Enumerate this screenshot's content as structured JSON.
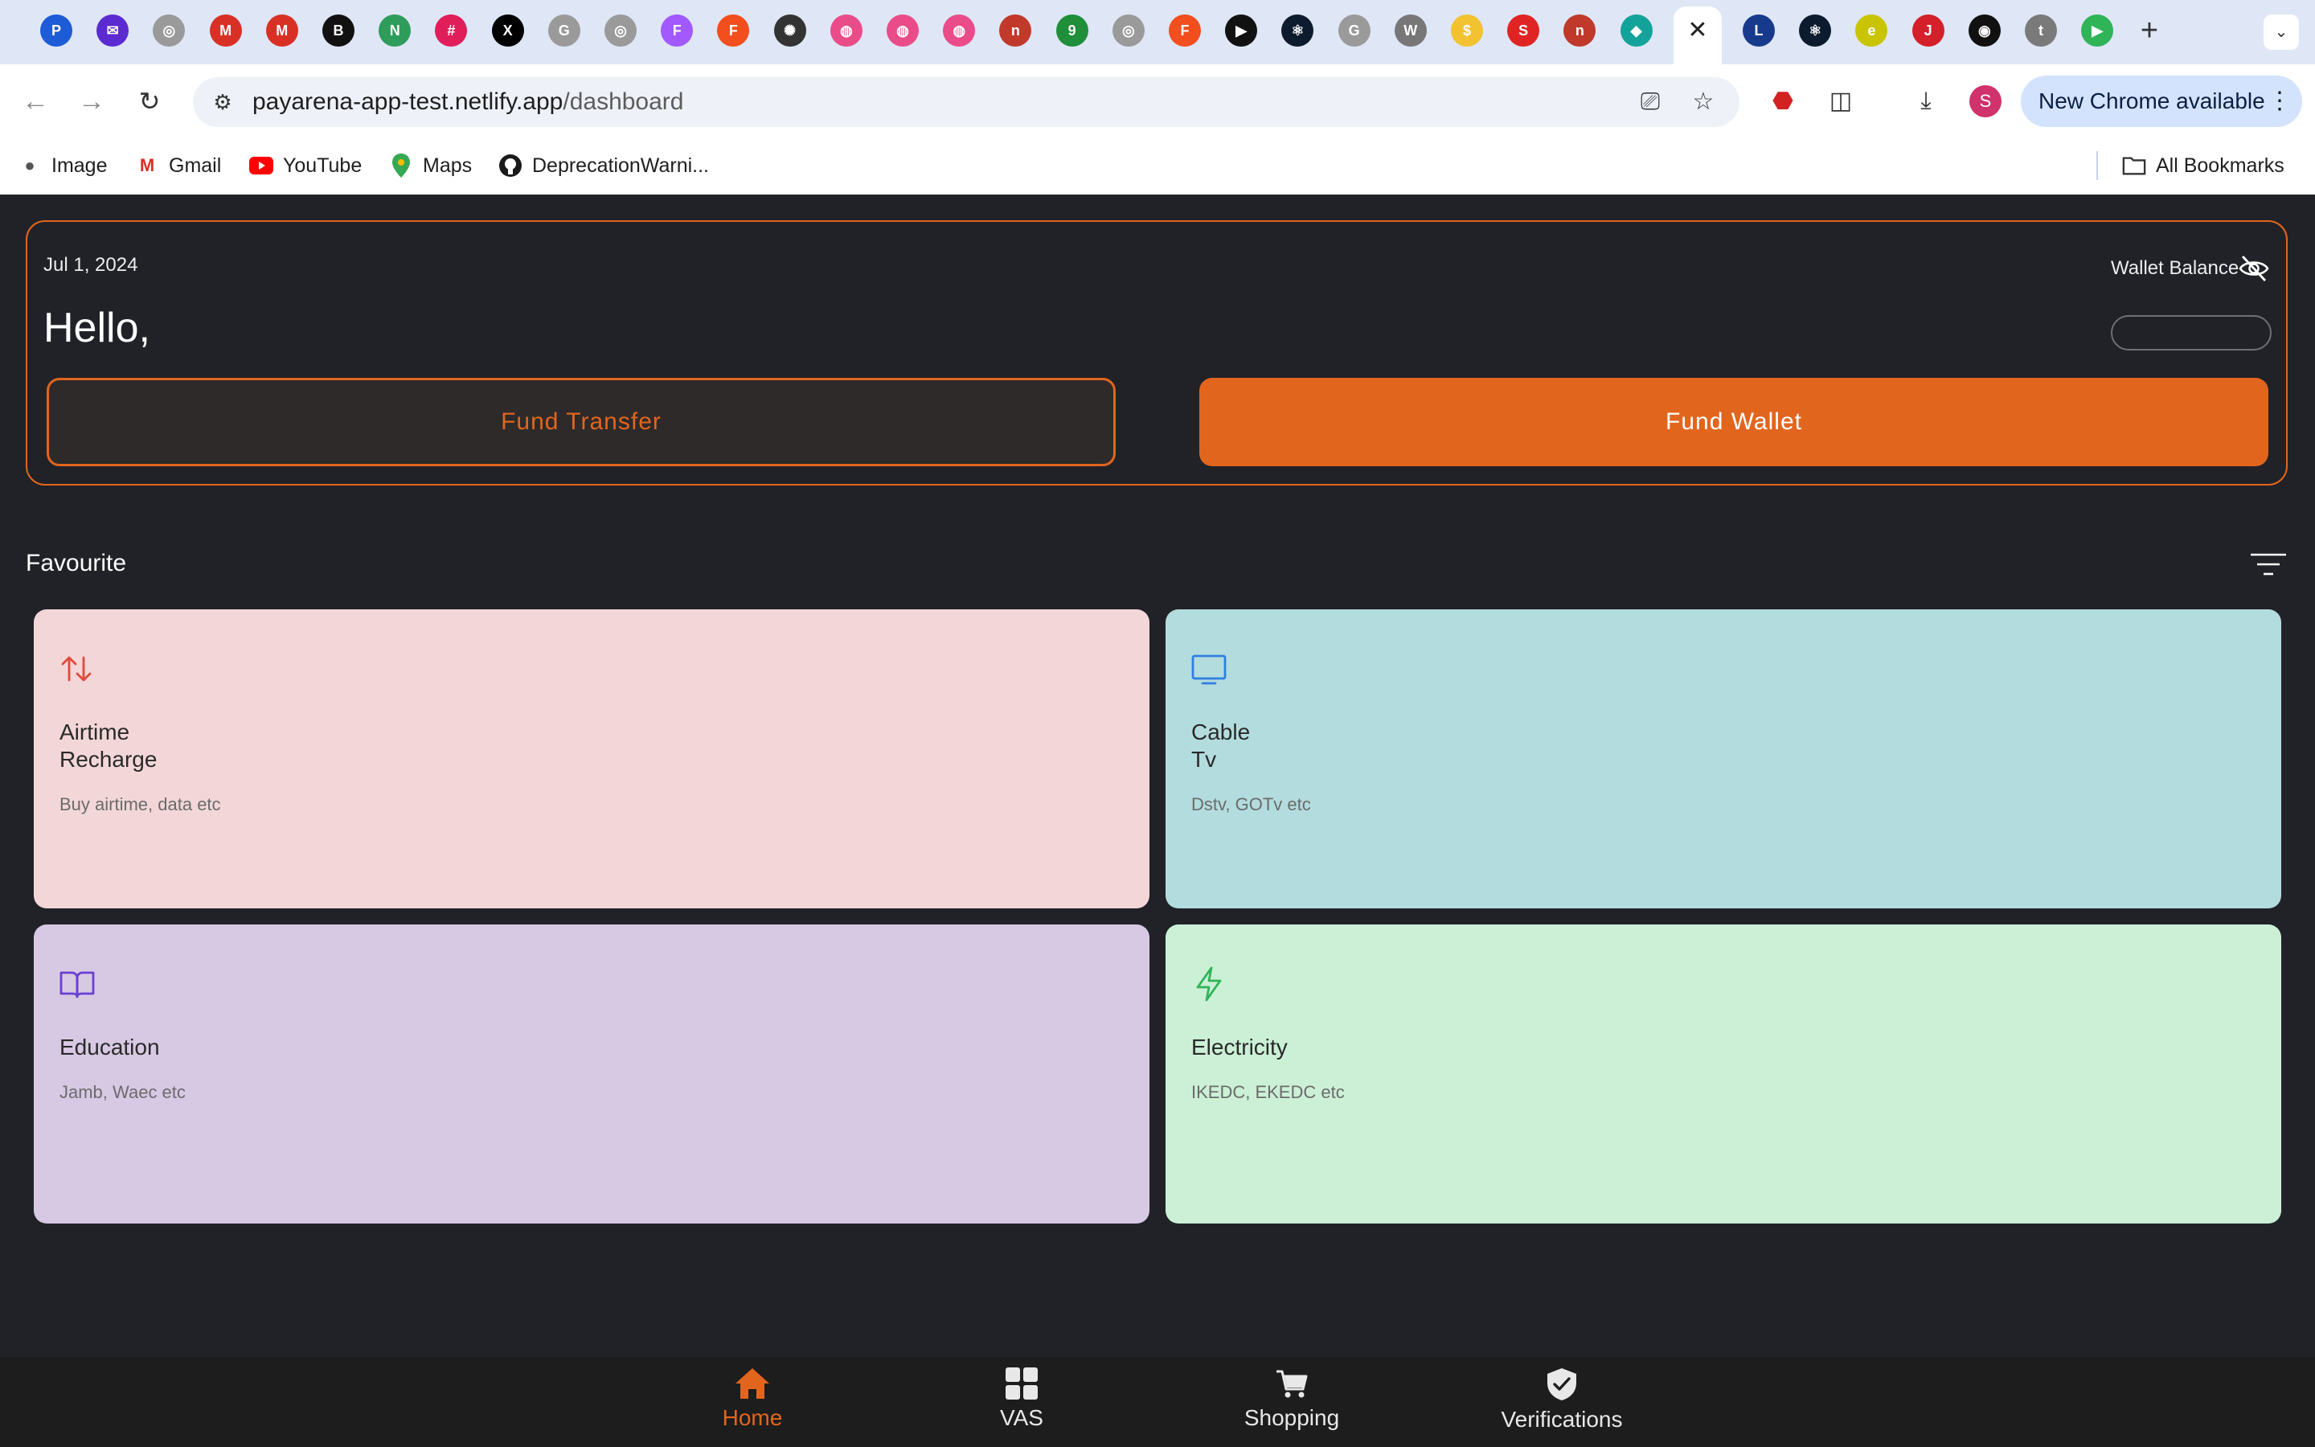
{
  "browser": {
    "tabs": [
      {
        "icon": "p-icon",
        "color": "#1e5bd6",
        "glyph": "P"
      },
      {
        "icon": "mail-icon",
        "color": "#5b2bd1",
        "glyph": "✉"
      },
      {
        "icon": "globe-icon",
        "color": "#9a9a9a",
        "glyph": "◎"
      },
      {
        "icon": "gmail-icon",
        "color": "#d93025",
        "glyph": "M"
      },
      {
        "icon": "gmail-icon",
        "color": "#d93025",
        "glyph": "M"
      },
      {
        "icon": "b-icon",
        "color": "#111111",
        "glyph": "B"
      },
      {
        "icon": "n-icon",
        "color": "#2e9c5a",
        "glyph": "N"
      },
      {
        "icon": "slack-icon",
        "color": "#e01e5a",
        "glyph": "#"
      },
      {
        "icon": "x-icon",
        "color": "#000000",
        "glyph": "X"
      },
      {
        "icon": "google-icon",
        "color": "#9a9a9a",
        "glyph": "G"
      },
      {
        "icon": "web-icon",
        "color": "#9a9a9a",
        "glyph": "◎"
      },
      {
        "icon": "figma-icon",
        "color": "#a259ff",
        "glyph": "F"
      },
      {
        "icon": "figma-icon",
        "color": "#f24e1e",
        "glyph": "F"
      },
      {
        "icon": "openai-icon",
        "color": "#333333",
        "glyph": "✺"
      },
      {
        "icon": "dribbble-icon",
        "color": "#ea4c89",
        "glyph": "◍"
      },
      {
        "icon": "dribbble-icon",
        "color": "#ea4c89",
        "glyph": "◍"
      },
      {
        "icon": "dribbble-icon",
        "color": "#ea4c89",
        "glyph": "◍"
      },
      {
        "icon": "n-icon",
        "color": "#c0392b",
        "glyph": "n"
      },
      {
        "icon": "9ja-icon",
        "color": "#1f8f3a",
        "glyph": "9"
      },
      {
        "icon": "web-icon",
        "color": "#9a9a9a",
        "glyph": "◎"
      },
      {
        "icon": "figma-icon",
        "color": "#f24e1e",
        "glyph": "F"
      },
      {
        "icon": "play-icon",
        "color": "#111111",
        "glyph": "▶"
      },
      {
        "icon": "react-icon",
        "color": "#0c1b2e",
        "glyph": "⚛"
      },
      {
        "icon": "google-icon",
        "color": "#9a9a9a",
        "glyph": "G"
      },
      {
        "icon": "wikipedia-icon",
        "color": "#777777",
        "glyph": "W"
      },
      {
        "icon": "bank-icon",
        "color": "#f2c230",
        "glyph": "$"
      },
      {
        "icon": "s-icon",
        "color": "#e02424",
        "glyph": "S"
      },
      {
        "icon": "n-icon",
        "color": "#c0392b",
        "glyph": "n"
      },
      {
        "icon": "diamond-icon",
        "color": "#14a39a",
        "glyph": "◆"
      }
    ],
    "tabs_after": [
      {
        "icon": "live-icon",
        "color": "#173a8c",
        "glyph": "L"
      },
      {
        "icon": "react-icon",
        "color": "#0c1b2e",
        "glyph": "⚛"
      },
      {
        "icon": "e-icon",
        "color": "#c9c400",
        "glyph": "e"
      },
      {
        "icon": "jpg-icon",
        "color": "#d4202a",
        "glyph": "J"
      },
      {
        "icon": "github-icon",
        "color": "#111111",
        "glyph": "◉"
      },
      {
        "icon": "tm-icon",
        "color": "#7a7a7a",
        "glyph": "t"
      },
      {
        "icon": "play-store-icon",
        "color": "#2fb457",
        "glyph": "▶"
      }
    ],
    "active_tab_close": "✕",
    "new_tab": "+",
    "tab_search": "⌄",
    "url_host": "payarena-app-test.netlify.app",
    "url_path": "/dashboard",
    "update_label": "New Chrome available",
    "profile_initial": "S",
    "bookmarks": [
      {
        "label": "Image",
        "icon": "globe-icon"
      },
      {
        "label": "Gmail",
        "icon": "gmail-icon"
      },
      {
        "label": "YouTube",
        "icon": "youtube-icon"
      },
      {
        "label": "Maps",
        "icon": "maps-icon"
      },
      {
        "label": "DeprecationWarni...",
        "icon": "github-icon"
      }
    ],
    "all_bookmarks": "All Bookmarks"
  },
  "dashboard": {
    "date": "Jul 1, 2024",
    "greeting": "Hello,",
    "wallet_label": "Wallet Balance",
    "fund_transfer": "Fund Transfer",
    "fund_wallet": "Fund Wallet",
    "accent": "#e2651e"
  },
  "favourite": {
    "title": "Favourite",
    "cards": [
      {
        "title": "Airtime\nRecharge",
        "subtitle": "Buy airtime, data etc",
        "icon": "transfer-arrows-icon",
        "bg": "#f3d7d8",
        "icon_color": "#e0493f"
      },
      {
        "title": "Cable\nTv",
        "subtitle": "Dstv, GOTv etc",
        "icon": "tv-icon",
        "bg": "#b3dcde",
        "icon_color": "#2f7fe0"
      },
      {
        "title": "Education",
        "subtitle": "Jamb, Waec etc",
        "icon": "book-icon",
        "bg": "#d7c9e4",
        "icon_color": "#6b3fd1"
      },
      {
        "title": "Electricity",
        "subtitle": "IKEDC, EKEDC etc",
        "icon": "lightning-icon",
        "bg": "#cbf0d6",
        "icon_color": "#2fb457"
      }
    ]
  },
  "bottom_nav": {
    "items": [
      {
        "label": "Home",
        "icon": "home-icon",
        "active": true
      },
      {
        "label": "VAS",
        "icon": "grid-icon",
        "active": false
      },
      {
        "label": "Shopping",
        "icon": "cart-icon",
        "active": false
      },
      {
        "label": "Verifications",
        "icon": "shield-check-icon",
        "active": false
      }
    ],
    "active_color": "#e2651e",
    "inactive_color": "#e8e8e8"
  }
}
